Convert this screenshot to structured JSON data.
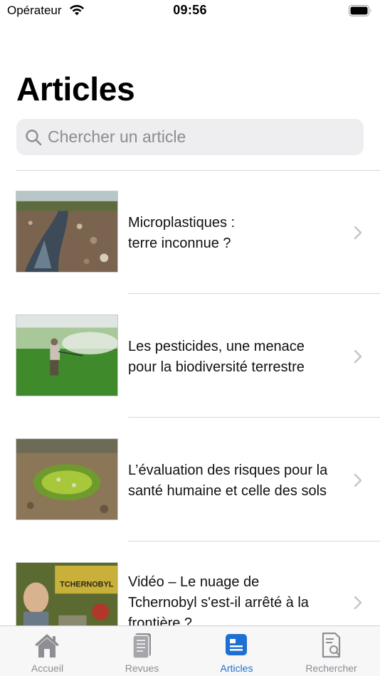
{
  "status_bar": {
    "carrier": "Opérateur",
    "time": "09:56"
  },
  "page_title": "Articles",
  "search": {
    "placeholder": "Chercher un article",
    "value": ""
  },
  "articles": [
    {
      "title": "Microplastiques :\nterre inconnue ?"
    },
    {
      "title": "Les pesticides, une menace\npour la biodiversité terrestre"
    },
    {
      "title": "L’évaluation des risques pour la\nsanté humaine et celle des sols"
    },
    {
      "title": "Vidéo – Le nuage de\nTchernobyl s'est-il arrêté à la\nfrontière ?"
    }
  ],
  "thumbnail_text": {
    "video_title": "TCHERNOBYL"
  },
  "tabs": [
    {
      "label": "Accueil",
      "icon": "home-icon"
    },
    {
      "label": "Revues",
      "icon": "book-icon"
    },
    {
      "label": "Articles",
      "icon": "article-icon",
      "active": true
    },
    {
      "label": "Rechercher",
      "icon": "document-search-icon"
    }
  ],
  "colors": {
    "accent": "#1d6fd3",
    "inactive_tab": "#8e8e93",
    "search_bg": "#eeeef0"
  }
}
